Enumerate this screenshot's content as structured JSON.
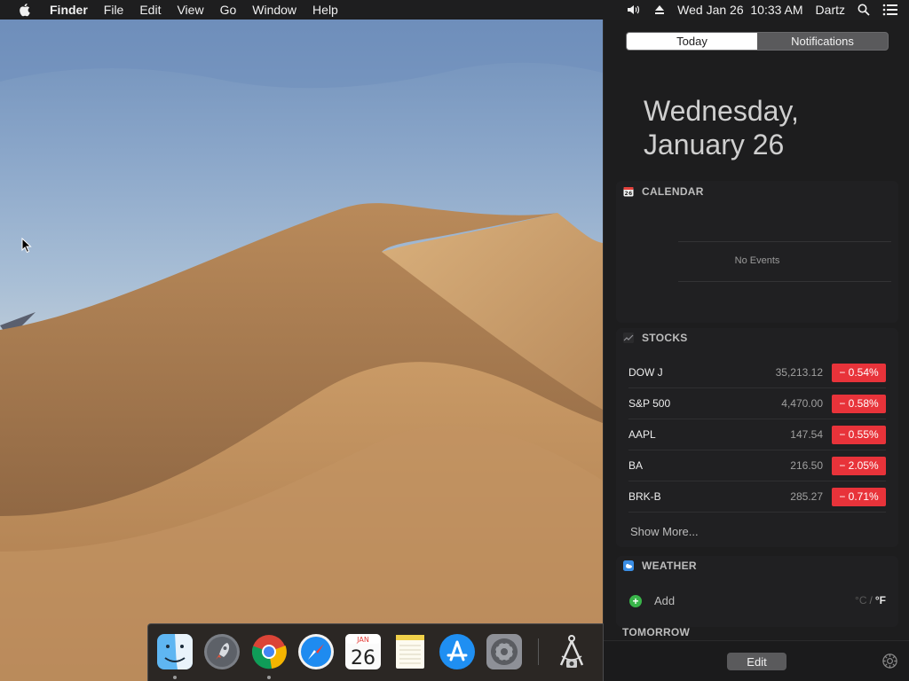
{
  "menubar": {
    "app_name": "Finder",
    "menus": [
      "File",
      "Edit",
      "View",
      "Go",
      "Window",
      "Help"
    ],
    "datetime": "Wed Jan 26  10:33 AM",
    "user": "Dartz"
  },
  "notification_center": {
    "tabs": [
      "Today",
      "Notifications"
    ],
    "active_tab": "Today",
    "date_line1": "Wednesday,",
    "date_line2": "January 26",
    "calendar": {
      "title": "CALENDAR",
      "empty_text": "No Events",
      "icon": "calendar-icon"
    },
    "stocks": {
      "title": "STOCKS",
      "icon": "stocks-icon",
      "rows": [
        {
          "symbol": "DOW J",
          "price": "35,213.12",
          "change": "− 0.54%"
        },
        {
          "symbol": "S&P 500",
          "price": "4,470.00",
          "change": "− 0.58%"
        },
        {
          "symbol": "AAPL",
          "price": "147.54",
          "change": "− 0.55%"
        },
        {
          "symbol": "BA",
          "price": "216.50",
          "change": "− 2.05%"
        },
        {
          "symbol": "BRK-B",
          "price": "285.27",
          "change": "− 0.71%"
        }
      ],
      "show_more": "Show More...",
      "negative_color": "#e8333a"
    },
    "weather": {
      "title": "WEATHER",
      "icon": "weather-icon",
      "add_label": "Add",
      "unit_c": "°C",
      "unit_sep": "/",
      "unit_f": "°F"
    },
    "tomorrow": {
      "title": "TOMORROW"
    },
    "edit_label": "Edit"
  },
  "dock": {
    "items": [
      {
        "name": "Finder",
        "icon": "finder-icon",
        "running": true
      },
      {
        "name": "Launchpad",
        "icon": "launchpad-icon",
        "running": false
      },
      {
        "name": "Google Chrome",
        "icon": "chrome-icon",
        "running": true
      },
      {
        "name": "Safari",
        "icon": "safari-icon",
        "running": false
      },
      {
        "name": "Calendar",
        "icon": "calendar-app-icon",
        "running": false,
        "month": "JAN",
        "day": "26"
      },
      {
        "name": "Notes",
        "icon": "notes-icon",
        "running": false
      },
      {
        "name": "App Store",
        "icon": "app-store-icon",
        "running": false
      },
      {
        "name": "System Preferences",
        "icon": "system-preferences-icon",
        "running": false
      },
      {
        "name": "Screenshot tool",
        "icon": "screenshot-tool-icon",
        "running": false
      }
    ]
  }
}
